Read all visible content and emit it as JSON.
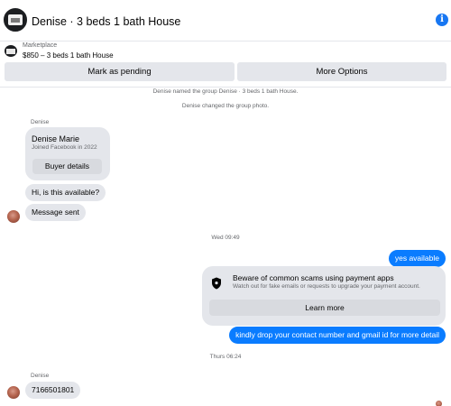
{
  "header": {
    "title": "Denise · 3 beds 1 bath House",
    "info_icon": "info-icon"
  },
  "listing": {
    "source": "Marketplace",
    "price_title": "$850 – 3 beds 1 bath House"
  },
  "actions": {
    "pending_label": "Mark as pending",
    "more_label": "More Options"
  },
  "system_messages": [
    "Denise named the group Denise · 3 beds 1 bath House.",
    "Denise changed the group photo."
  ],
  "contact_card": {
    "sender": "Denise",
    "name": "Denise Marie",
    "joined": "Joined Facebook in 2022",
    "button_label": "Buyer details"
  },
  "messages": {
    "incoming_1": "Hi, is this available?",
    "incoming_2": "Message sent",
    "timestamp_1": "Wed 09:49",
    "outgoing_1": "yes available",
    "scam_title": "Beware of common scams using payment apps",
    "scam_body": "Watch out for fake emails or requests to upgrade your payment account.",
    "scam_button": "Learn more",
    "outgoing_2": "kindly drop your contact number and gmail id for more detail",
    "timestamp_2": "Thurs 06:24",
    "sender_2": "Denise",
    "incoming_3": "7166501801"
  },
  "colors": {
    "accent": "#0a7cff",
    "info": "#1877f2",
    "bubble_gray": "#e4e6eb"
  }
}
